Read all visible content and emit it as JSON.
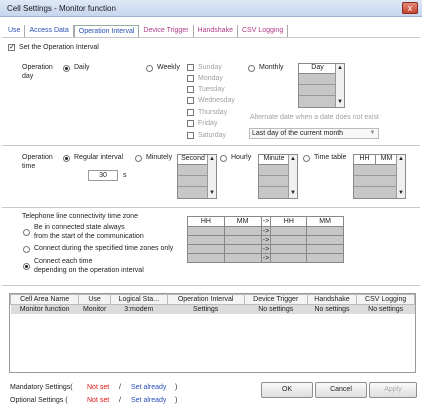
{
  "window": {
    "title": "Cell Settings - Monitor function",
    "close": "x"
  },
  "tabs": [
    {
      "label": "Use"
    },
    {
      "label": "Access Data"
    },
    {
      "label": "Operation Interval"
    },
    {
      "label": "Device Trigger"
    },
    {
      "label": "Handshake"
    },
    {
      "label": "CSV Logging"
    }
  ],
  "set_interval": {
    "label": "Set the Operation Interval",
    "checked": true
  },
  "day": {
    "label_line1": "Operation",
    "label_line2": "day",
    "daily": "Daily",
    "weekly": "Weekly",
    "monthly": "Monthly",
    "weekdays": [
      "Sunday",
      "Monday",
      "Tuesday",
      "Wednesday",
      "Thursday",
      "Friday",
      "Saturday"
    ],
    "day_list_header": "Day",
    "alternate_label": "Alternate date when a date does not exist",
    "alternate_value": "Last day of the current month"
  },
  "time": {
    "label_line1": "Operation",
    "label_line2": "time",
    "regular": "Regular interval",
    "minutely": "Minutely",
    "hourly": "Hourly",
    "timetable": "Time table",
    "interval_value": "30",
    "interval_unit": "s",
    "second_header": "Second",
    "minute_header": "Minute",
    "hh": "HH",
    "mm": "MM"
  },
  "telephone": {
    "title": "Telephone line connectivity time zone",
    "opt1_line1": "Be in connected state always",
    "opt1_line2": "from the start of the communication",
    "opt2": "Connect during the specified time zones only",
    "opt3_line1": "Connect each time",
    "opt3_line2": "depending on the operation interval",
    "col_hh": "HH",
    "col_mm": "MM",
    "arrow": "->",
    "colon": ":"
  },
  "grid": {
    "columns": [
      "Cell Area Name",
      "Use",
      "Logical Sta...",
      "Operation Interval",
      "Device Trigger",
      "Handshake",
      "CSV Logging"
    ],
    "rows": [
      [
        "Monitor function",
        "Monitor",
        "3:modem",
        "Settings",
        "No settings",
        "No settings",
        "No settings"
      ]
    ]
  },
  "footer": {
    "mandatory_label": "Mandatory Settings(",
    "optional_label": "Optional Settings  (",
    "not_set": "Not set",
    "slash": "/",
    "set_already": "Set already",
    "close_paren": ")",
    "ok": "OK",
    "cancel": "Cancel",
    "apply": "Apply"
  }
}
